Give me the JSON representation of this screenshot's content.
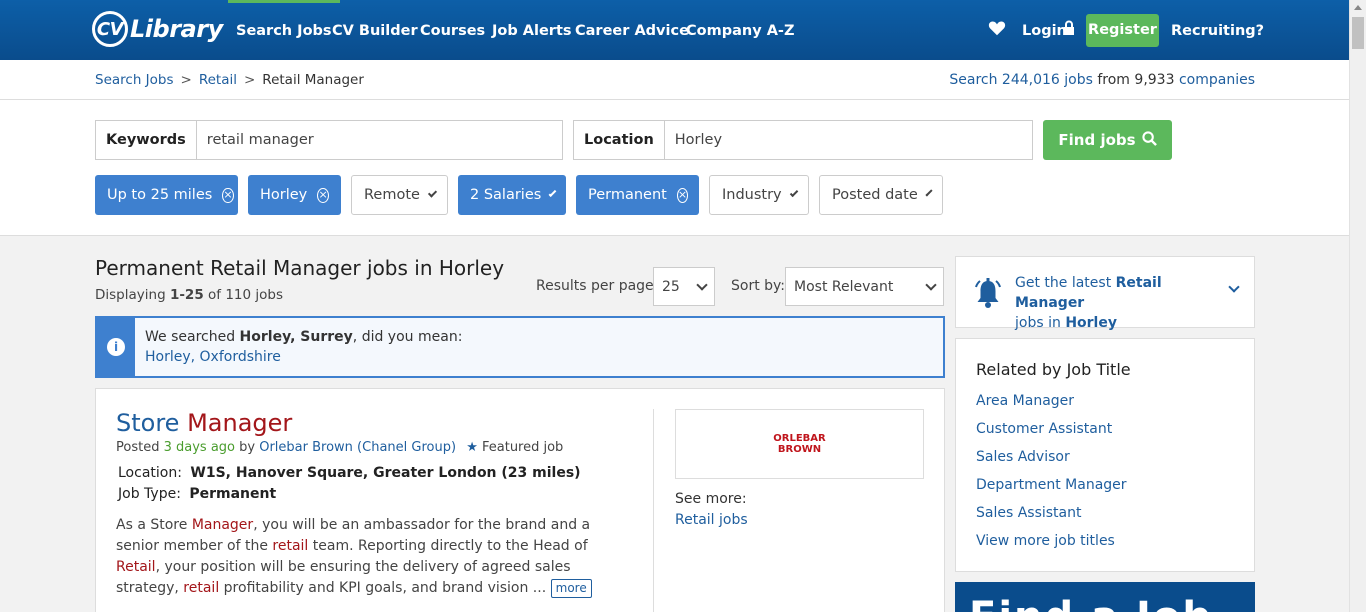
{
  "header": {
    "logo_cv": "CV",
    "logo_library": "Library",
    "nav": [
      {
        "label": "Search Jobs"
      },
      {
        "label": "CV Builder"
      },
      {
        "label": "Courses"
      },
      {
        "label": "Job Alerts"
      },
      {
        "label": "Career Advice"
      },
      {
        "label": "Company A-Z"
      }
    ],
    "login": "Login",
    "register": "Register",
    "recruiting": "Recruiting?"
  },
  "breadcrumb": {
    "items": [
      "Search Jobs",
      "Retail",
      "Retail Manager"
    ],
    "separator": ">"
  },
  "stats": {
    "prefix": "Search",
    "jobs": "244,016 jobs",
    "from": "from",
    "companies_count": "9,933",
    "companies": "companies"
  },
  "search": {
    "keywords_label": "Keywords",
    "keywords_value": "retail manager",
    "location_label": "Location",
    "location_value": "Horley",
    "find_button": "Find jobs"
  },
  "filters": [
    {
      "label": "Up to 25 miles",
      "active": true
    },
    {
      "label": "Horley",
      "active": true
    },
    {
      "label": "Remote",
      "active": false
    },
    {
      "label": "2 Salaries",
      "active": true
    },
    {
      "label": "Permanent",
      "active": true
    },
    {
      "label": "Industry",
      "active": false
    },
    {
      "label": "Posted date",
      "active": false
    }
  ],
  "results": {
    "title": "Permanent Retail Manager jobs in Horley",
    "displaying_prefix": "Displaying",
    "displaying_range": "1-25",
    "displaying_suffix": "of 110 jobs",
    "rpp_label": "Results per page:",
    "rpp_value": "25",
    "sort_label": "Sort by:",
    "sort_value": "Most Relevant"
  },
  "notice": {
    "prefix": "We searched",
    "searched": "Horley, Surrey",
    "suffix": ", did you mean:",
    "suggestion": "Horley, Oxfordshire"
  },
  "job": {
    "title_word1": "Store",
    "title_word2": "Manager",
    "posted_prefix": "Posted",
    "posted_age": "3 days ago",
    "posted_by": "by",
    "company": "Orlebar Brown (Chanel Group)",
    "featured": "Featured job",
    "location_label": "Location:",
    "location_value": "W1S, Hanover Square, Greater London (23 miles)",
    "type_label": "Job Type:",
    "type_value": "Permanent",
    "desc_parts": [
      "As a Store ",
      "Manager",
      ", you will be an ambassador for the brand and a senior member of the ",
      "retail",
      " team. Reporting directly to the Head of ",
      "Retail",
      ", your position will be ensuring the delivery of agreed sales strategy, ",
      "retail",
      " profitability and KPI goals, and brand vision ..."
    ],
    "more": "more",
    "company_logo_line1": "ORLEBAR",
    "company_logo_line2": "BROWN",
    "see_more": "See more:",
    "see_more_link": "Retail jobs"
  },
  "alert": {
    "prefix": "Get the latest",
    "title": "Retail Manager",
    "middle": "jobs in",
    "location": "Horley"
  },
  "related": {
    "heading": "Related by Job Title",
    "items": [
      "Area Manager",
      "Customer Assistant",
      "Sales Advisor",
      "Department Manager",
      "Sales Assistant",
      "View more job titles"
    ]
  },
  "banner": {
    "text": "Find a Job"
  },
  "colors": {
    "header_blue": "#0a4c8c",
    "accent_green": "#5cb85c",
    "filter_active": "#3e80cf",
    "link_blue": "#1f5e9e",
    "highlight_red": "#a3161a"
  }
}
